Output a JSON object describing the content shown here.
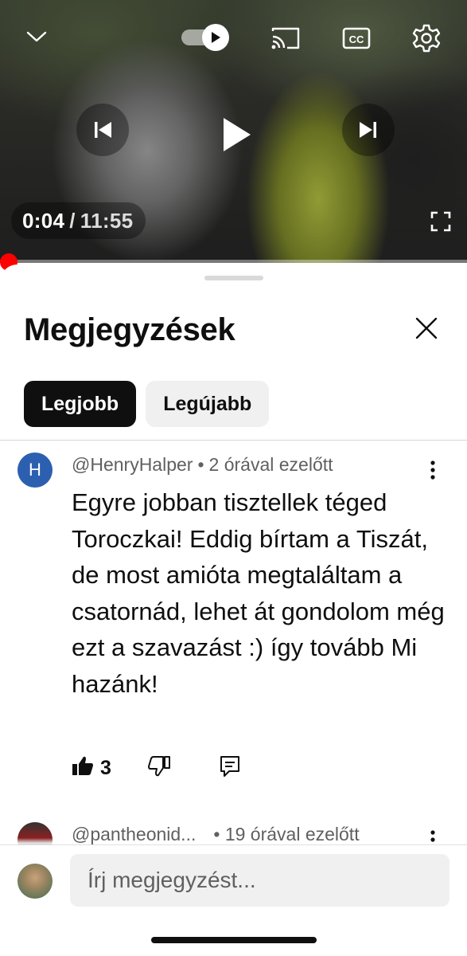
{
  "player": {
    "current_time": "0:04",
    "separator": "/",
    "duration": "11:55",
    "progress_fraction": 0.006,
    "autoplay_on": true,
    "icons": {
      "collapse": "chevron-down-icon",
      "autoplay": "autoplay-toggle-icon",
      "cast": "cast-icon",
      "captions": "captions-icon",
      "settings": "gear-icon",
      "previous": "previous-icon",
      "play": "play-icon",
      "next": "next-icon",
      "fullscreen": "fullscreen-icon"
    }
  },
  "comments_panel": {
    "title": "Megjegyzések",
    "sort_chips": [
      {
        "label": "Legjobb",
        "active": true
      },
      {
        "label": "Legújabb",
        "active": false
      }
    ],
    "comments": [
      {
        "avatar_letter": "H",
        "avatar_color": "#2d5fb0",
        "author": "@HenryHalper",
        "time": "2 órával ezelőtt",
        "text": "Egyre jobban tisztellek téged Toroczkai! Eddig bírtam a Tiszát, de most amióta megtaláltam a csatornád, lehet át gondolom még ezt a szavazást :) így tovább Mi hazánk!",
        "likes": "3"
      },
      {
        "author": "@pantheonid...",
        "time": "19 órával ezelőtt"
      }
    ],
    "composer": {
      "placeholder": "Írj megjegyzést..."
    }
  },
  "colors": {
    "accent_red": "#ff0000",
    "chip_active_bg": "#0f0f0f",
    "chip_inactive_bg": "#f0f0f0",
    "meta_text": "#606060"
  }
}
